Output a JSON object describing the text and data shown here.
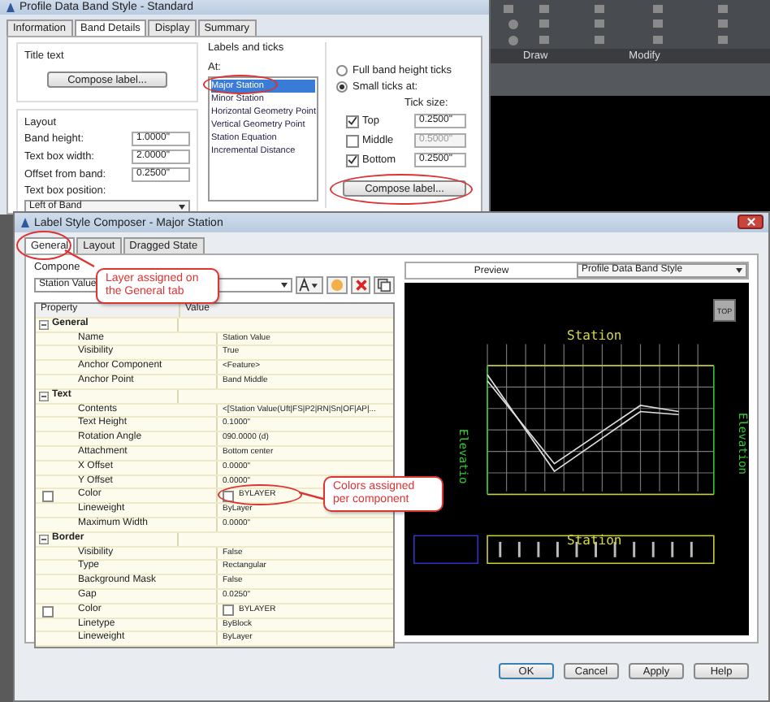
{
  "back_window": {
    "title": "Profile Data Band Style - Standard",
    "tabs": [
      {
        "label": "Information",
        "selected": false
      },
      {
        "label": "Band Details",
        "selected": true
      },
      {
        "label": "Display",
        "selected": false
      },
      {
        "label": "Summary",
        "selected": false
      }
    ],
    "title_text": {
      "heading": "Title text",
      "button": "Compose label..."
    },
    "layout": {
      "heading": "Layout",
      "fields": [
        {
          "label": "Band height:",
          "value": "1.0000\""
        },
        {
          "label": "Text box width:",
          "value": "2.0000\""
        },
        {
          "label": "Offset from band:",
          "value": "0.2500\""
        }
      ],
      "position_label": "Text box position:",
      "position_value": "Left of Band"
    },
    "labels_and_ticks": {
      "heading": "Labels and ticks",
      "at_label": "At:",
      "items": [
        {
          "label": "Major Station",
          "selected": true
        },
        {
          "label": "Minor Station",
          "selected": false
        },
        {
          "label": "Horizontal Geometry Point",
          "selected": false
        },
        {
          "label": "Vertical Geometry Point",
          "selected": false
        },
        {
          "label": "Station Equation",
          "selected": false
        },
        {
          "label": "Incremental Distance",
          "selected": false
        }
      ]
    },
    "ticks": {
      "options": [
        {
          "label": "Full band height ticks",
          "selected": false
        },
        {
          "label": "Small ticks at:",
          "selected": true
        }
      ],
      "size_label": "Tick size:",
      "positions": [
        {
          "label": "Top",
          "checked": true,
          "value": "0.2500\"",
          "disabled": false
        },
        {
          "label": "Middle",
          "checked": false,
          "value": "0.5000\"",
          "disabled": true
        },
        {
          "label": "Bottom",
          "checked": true,
          "value": "0.2500\"",
          "disabled": false
        }
      ],
      "button": "Compose label..."
    }
  },
  "ribbon": {
    "panels": [
      "Draw",
      "Modify"
    ]
  },
  "dialog": {
    "title": "Label Style Composer - Major Station",
    "tabs": [
      {
        "label": "General",
        "selected": true
      },
      {
        "label": "Layout",
        "selected": false
      },
      {
        "label": "Dragged State",
        "selected": false
      }
    ],
    "component_label": "Compone",
    "component_value": "Station Value",
    "columns": [
      "Property",
      "Value"
    ],
    "groups": [
      {
        "name": "General",
        "expanded": true,
        "rows": [
          {
            "kind": "text",
            "property": "Name",
            "value": "Station Value"
          },
          {
            "kind": "text",
            "property": "Visibility",
            "value": "True"
          },
          {
            "kind": "text",
            "property": "Anchor Component",
            "value": "<Feature>"
          },
          {
            "kind": "text",
            "property": "Anchor Point",
            "value": "Band Middle"
          }
        ]
      },
      {
        "name": "Text",
        "expanded": true,
        "rows": [
          {
            "kind": "text",
            "property": "Contents",
            "value": "<[Station Value(Uft|FS|P2|RN|Sn|OF|AP|..."
          },
          {
            "kind": "text",
            "property": "Text Height",
            "value": "0.1000\""
          },
          {
            "kind": "text",
            "property": "Rotation Angle",
            "value": "090.0000 (d)"
          },
          {
            "kind": "text",
            "property": "Attachment",
            "value": "Bottom center"
          },
          {
            "kind": "text",
            "property": "X Offset",
            "value": "0.0000\""
          },
          {
            "kind": "text",
            "property": "Y Offset",
            "value": "0.0000\""
          },
          {
            "kind": "color",
            "property": "Color",
            "value": "BYLAYER",
            "checked": false
          },
          {
            "kind": "text",
            "property": "Lineweight",
            "value": "ByLayer"
          },
          {
            "kind": "text",
            "property": "Maximum Width",
            "value": "0.0000\""
          }
        ]
      },
      {
        "name": "Border",
        "expanded": true,
        "rows": [
          {
            "kind": "text",
            "property": "Visibility",
            "value": "False"
          },
          {
            "kind": "text",
            "property": "Type",
            "value": "Rectangular"
          },
          {
            "kind": "text",
            "property": "Background Mask",
            "value": "False"
          },
          {
            "kind": "text",
            "property": "Gap",
            "value": "0.0250\""
          },
          {
            "kind": "color",
            "property": "Color",
            "value": "BYLAYER",
            "checked": false
          },
          {
            "kind": "text",
            "property": "Linetype",
            "value": "ByBlock"
          },
          {
            "kind": "text",
            "property": "Lineweight",
            "value": "ByLayer"
          }
        ]
      }
    ],
    "preview_label": "Preview",
    "preview_style": "Profile Data Band Style",
    "preview_view_button": "TOP",
    "preview_texts": {
      "title": "Station",
      "band_title": "Station",
      "left_axis": "Elevatio",
      "right_axis": "Elevation"
    },
    "buttons": [
      "OK",
      "Cancel",
      "Apply",
      "Help"
    ]
  },
  "callouts": [
    "Layer assigned on the General tab",
    "Colors assigned per component"
  ]
}
